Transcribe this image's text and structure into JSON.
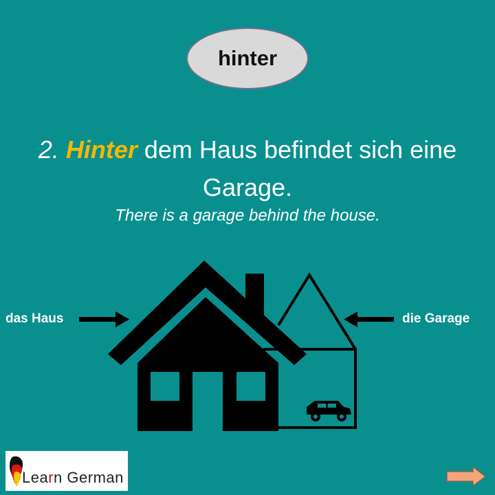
{
  "header": {
    "word": "hinter"
  },
  "sentence": {
    "number": "2.",
    "keyword": "Hinter",
    "rest": " dem Haus befindet sich eine Garage."
  },
  "translation": "There is a garage behind the house.",
  "labels": {
    "house": "das Haus",
    "garage": "die Garage"
  },
  "logo": {
    "text_a": "Lea",
    "text_b": "r",
    "text_c": "n German"
  },
  "navigation": {
    "next_icon": "arrow-right-icon"
  },
  "colors": {
    "background": "#0a8f8f",
    "keyword": "#f5b800",
    "pill": "#d9d9d9",
    "next_arrow": "#f4a57a"
  }
}
